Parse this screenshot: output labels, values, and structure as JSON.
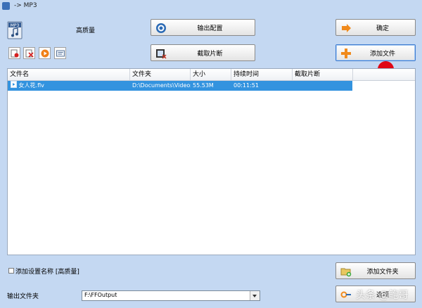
{
  "window": {
    "title": "-> MP3"
  },
  "profile": {
    "quality": "高质量"
  },
  "buttons": {
    "output_settings": "输出配置",
    "clip": "截取片断",
    "ok": "确定",
    "add_file": "添加文件",
    "add_folder": "添加文件夹",
    "options": "选项"
  },
  "toolbar": {
    "icons": [
      "remove-file-icon",
      "clear-list-icon",
      "play-icon",
      "media-info-icon"
    ]
  },
  "table": {
    "headers": [
      "文件名",
      "文件夹",
      "大小",
      "持续时间",
      "截取片断"
    ],
    "rows": [
      {
        "name": "女人花.flv",
        "folder": "D:\\Documents\\Videos",
        "size": "55.53M",
        "duration": "00:11:51",
        "clip": ""
      }
    ]
  },
  "settings": {
    "add_setting_name_label": "添加设置名称 [高质量]",
    "add_setting_name_checked": false
  },
  "output": {
    "label": "输出文件夹",
    "value": "F:\\FFOutput"
  },
  "watermark": {
    "text": "头条 @鲍哥"
  },
  "colors": {
    "accent": "#3393df",
    "marker": "#e00716",
    "background": "#c4d8f2"
  }
}
